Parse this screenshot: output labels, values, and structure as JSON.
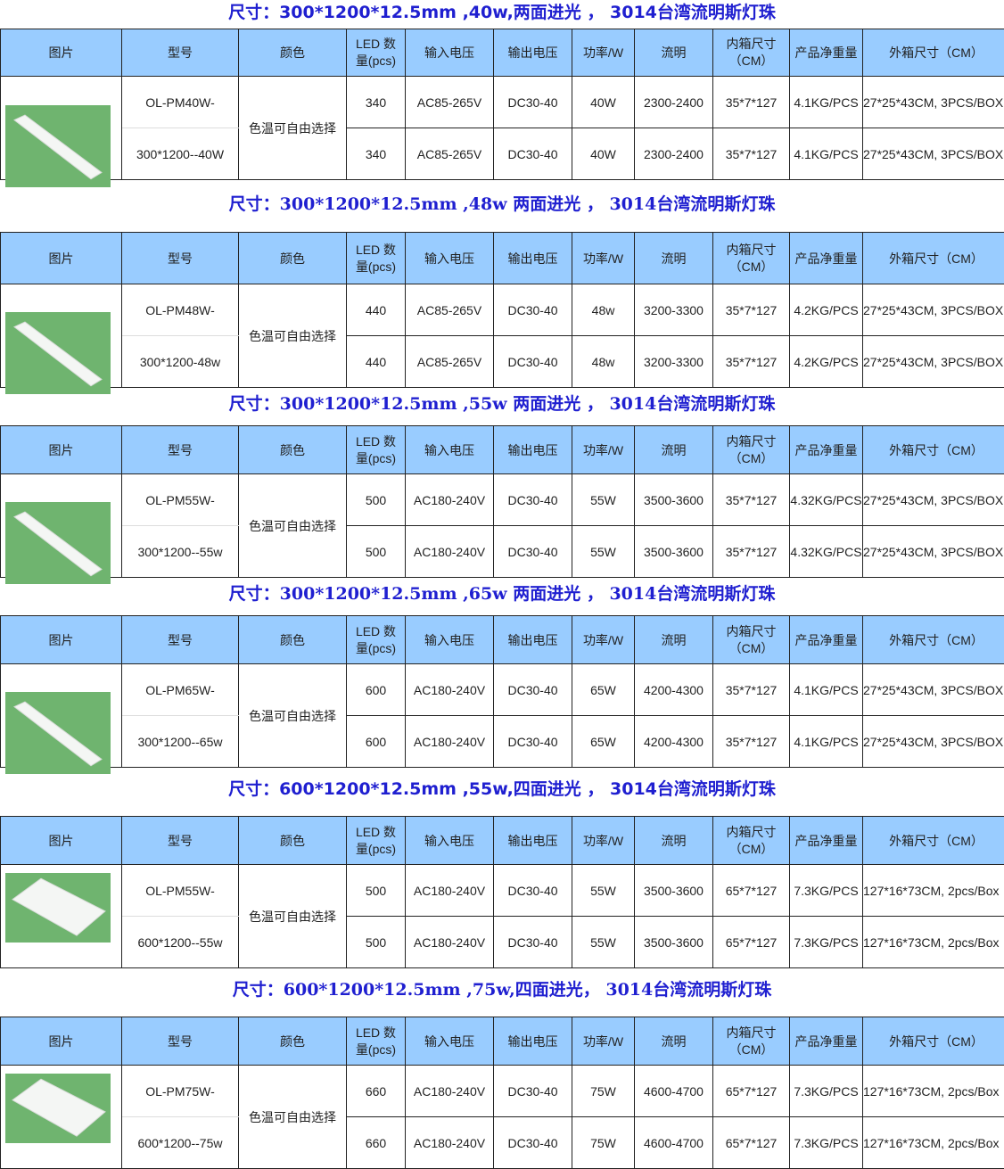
{
  "headers": [
    "图片",
    "型号",
    "颜色",
    "LED 数\n量(pcs)",
    "输入电压",
    "输出电压",
    "功率/W",
    "流明",
    "内箱尺寸\n（CM）",
    "产品净重量",
    "外箱尺寸（CM）"
  ],
  "sections": [
    {
      "title": "尺寸：300*1200*12.5mm ,40w,两面进光 ， 3014台湾流明斯灯珠",
      "color": "色温可自由选择",
      "rows": [
        {
          "model": "OL-PM40W-",
          "led": "340",
          "vin": "AC85-265V",
          "vout": "DC30-40",
          "power": "40W",
          "lumen": "2300-2400",
          "inner": "35*7*127",
          "weight": "4.1KG/PCS",
          "outer": "27*25*43CM, 3PCS/BOX"
        },
        {
          "model": "300*1200--40W",
          "led": "340",
          "vin": "AC85-265V",
          "vout": "DC30-40",
          "power": "40W",
          "lumen": "2300-2400",
          "inner": "35*7*127",
          "weight": "4.1KG/PCS",
          "outer": "27*25*43CM, 3PCS/BOX"
        }
      ]
    },
    {
      "title": "尺寸：300*1200*12.5mm ,48w 两面进光 ， 3014台湾流明斯灯珠",
      "color": "色温可自由选择",
      "rows": [
        {
          "model": "OL-PM48W-",
          "led": "440",
          "vin": "AC85-265V",
          "vout": "DC30-40",
          "power": "48w",
          "lumen": "3200-3300",
          "inner": "35*7*127",
          "weight": "4.2KG/PCS",
          "outer": "27*25*43CM, 3PCS/BOX"
        },
        {
          "model": "300*1200-48w",
          "led": "440",
          "vin": "AC85-265V",
          "vout": "DC30-40",
          "power": "48w",
          "lumen": "3200-3300",
          "inner": "35*7*127",
          "weight": "4.2KG/PCS",
          "outer": "27*25*43CM, 3PCS/BOX"
        }
      ]
    },
    {
      "title": "尺寸：300*1200*12.5mm ,55w 两面进光 ， 3014台湾流明斯灯珠",
      "color": "色温可自由选择",
      "rows": [
        {
          "model": "OL-PM55W-",
          "led": "500",
          "vin": "AC180-240V",
          "vout": "DC30-40",
          "power": "55W",
          "lumen": "3500-3600",
          "inner": "35*7*127",
          "weight": "4.32KG/PCS",
          "outer": "27*25*43CM, 3PCS/BOX"
        },
        {
          "model": "300*1200--55w",
          "led": "500",
          "vin": "AC180-240V",
          "vout": "DC30-40",
          "power": "55W",
          "lumen": "3500-3600",
          "inner": "35*7*127",
          "weight": "4.32KG/PCS",
          "outer": "27*25*43CM, 3PCS/BOX"
        }
      ]
    },
    {
      "title": "尺寸：300*1200*12.5mm ,65w 两面进光 ， 3014台湾流明斯灯珠",
      "color": "色温可自由选择",
      "rows": [
        {
          "model": "OL-PM65W-",
          "led": "600",
          "vin": "AC180-240V",
          "vout": "DC30-40",
          "power": "65W",
          "lumen": "4200-4300",
          "inner": "35*7*127",
          "weight": "4.1KG/PCS",
          "outer": "27*25*43CM, 3PCS/BOX"
        },
        {
          "model": "300*1200--65w",
          "led": "600",
          "vin": "AC180-240V",
          "vout": "DC30-40",
          "power": "65W",
          "lumen": "4200-4300",
          "inner": "35*7*127",
          "weight": "4.1KG/PCS",
          "outer": "27*25*43CM, 3PCS/BOX"
        }
      ]
    },
    {
      "title": "尺寸：600*1200*12.5mm ,55w,四面进光 ， 3014台湾流明斯灯珠",
      "color": "色温可自由选择",
      "rows": [
        {
          "model": "OL-PM55W-",
          "led": "500",
          "vin": "AC180-240V",
          "vout": "DC30-40",
          "power": "55W",
          "lumen": "3500-3600",
          "inner": "65*7*127",
          "weight": "7.3KG/PCS",
          "outer": "127*16*73CM, 2pcs/Box"
        },
        {
          "model": "600*1200--55w",
          "led": "500",
          "vin": "AC180-240V",
          "vout": "DC30-40",
          "power": "55W",
          "lumen": "3500-3600",
          "inner": "65*7*127",
          "weight": "7.3KG/PCS",
          "outer": "127*16*73CM, 2pcs/Box"
        }
      ]
    },
    {
      "title": "尺寸：600*1200*12.5mm ,75w,四面进光， 3014台湾流明斯灯珠",
      "color": "色温可自由选择",
      "rows": [
        {
          "model": "OL-PM75W-",
          "led": "660",
          "vin": "AC180-240V",
          "vout": "DC30-40",
          "power": "75W",
          "lumen": "4600-4700",
          "inner": "65*7*127",
          "weight": "7.3KG/PCS",
          "outer": "127*16*73CM, 2pcs/Box"
        },
        {
          "model": "600*1200--75w",
          "led": "660",
          "vin": "AC180-240V",
          "vout": "DC30-40",
          "power": "75W",
          "lumen": "4600-4700",
          "inner": "65*7*127",
          "weight": "7.3KG/PCS",
          "outer": "127*16*73CM, 2pcs/Box"
        }
      ]
    }
  ]
}
